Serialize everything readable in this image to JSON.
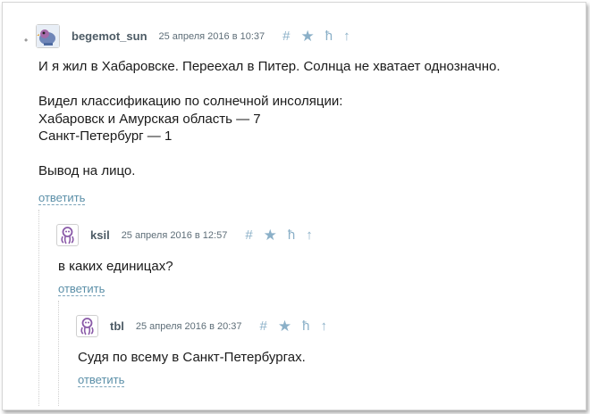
{
  "comments": [
    {
      "username": "begemot_sun",
      "date": "25 апреля 2016 в 10:37",
      "text": "И я жил в Хабаровске. Переехал в Питер. Солнца не хватает однозначно.\n\nВидел классификацию по солнечной инсоляции:\nХабаровск и Амурская область — 7\nСанкт-Петербург — 1\n\nВывод на лицо.",
      "reply_label": "ответить",
      "avatar_icon": "bird-avatar-icon"
    },
    {
      "username": "ksil",
      "date": "25 апреля 2016 в 12:57",
      "text": "в каких единицах?",
      "reply_label": "ответить",
      "avatar_icon": "octopus-avatar-icon"
    },
    {
      "username": "tbl",
      "date": "25 апреля 2016 в 20:37",
      "text": "Судя по всему в Санкт-Петербургах.",
      "reply_label": "ответить",
      "avatar_icon": "octopus-avatar-icon"
    }
  ],
  "actions": {
    "hash": "#",
    "star": "★",
    "parent": "ħ",
    "up": "↑"
  },
  "colors": {
    "accent": "#8bb0c8",
    "username": "#4d5b65",
    "link": "#5b8fa8",
    "avatar_purple": "#8a5aa8"
  }
}
